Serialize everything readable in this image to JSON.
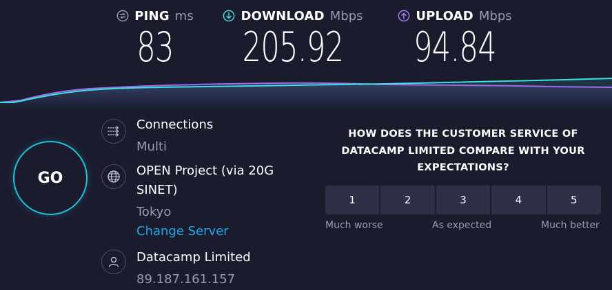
{
  "metrics": {
    "ping": {
      "label": "PING",
      "unit": "ms",
      "value": "83",
      "icon": "ping-icon",
      "color": "#9a9cad"
    },
    "download": {
      "label": "DOWNLOAD",
      "unit": "Mbps",
      "value": "205.92",
      "icon": "download-arrow-icon",
      "color": "#3ee0e0"
    },
    "upload": {
      "label": "UPLOAD",
      "unit": "Mbps",
      "value": "94.84",
      "icon": "upload-arrow-icon",
      "color": "#b07cf0"
    }
  },
  "graph": {
    "download_color": "#3ee0e0",
    "upload_color": "#9b6cf0"
  },
  "go_button": {
    "label": "GO",
    "color": "#1fc2d6"
  },
  "connection": {
    "icon": "connections-icon",
    "title": "Connections",
    "value": "Multi"
  },
  "server": {
    "icon": "globe-icon",
    "name_line1": "OPEN Project (via 20G",
    "name_line2": "SINET)",
    "location": "Tokyo",
    "change_link": "Change Server"
  },
  "provider": {
    "icon": "user-icon",
    "name": "Datacamp Limited",
    "ip": "89.187.161.157"
  },
  "survey": {
    "question_line1": "HOW DOES THE CUSTOMER SERVICE OF",
    "question_line2": "DATACAMP LIMITED COMPARE WITH YOUR",
    "question_line3": "EXPECTATIONS?",
    "ratings": [
      "1",
      "2",
      "3",
      "4",
      "5"
    ],
    "low_label": "Much worse",
    "mid_label": "As expected",
    "high_label": "Much better"
  },
  "colors": {
    "background": "#1a1c2e",
    "accent_link": "#1fa8ea",
    "button_bg": "#2e3048"
  }
}
